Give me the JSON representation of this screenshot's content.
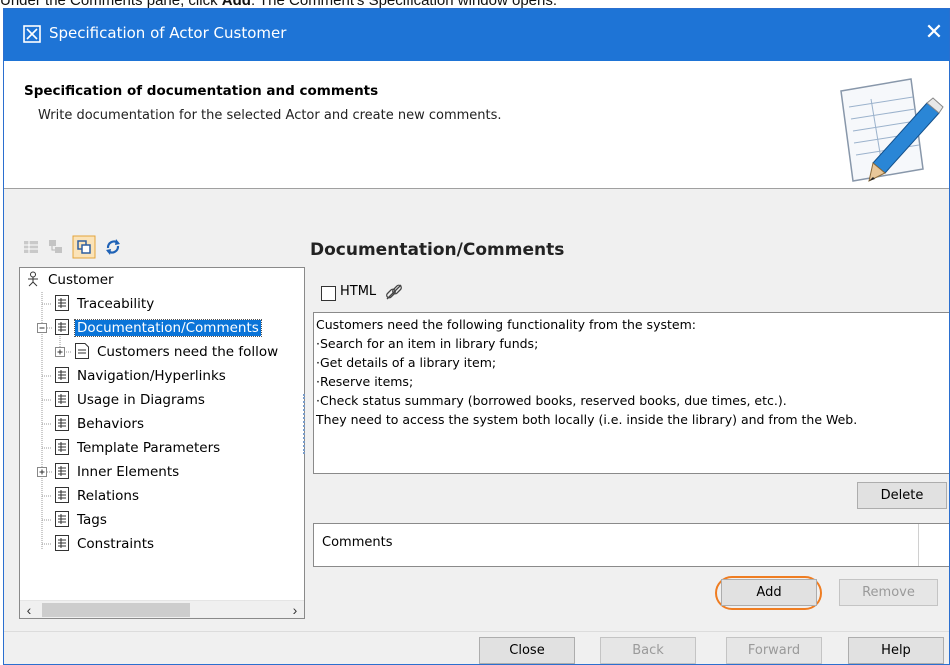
{
  "caption": {
    "prefix": "Under the Comments pane, click ",
    "bold": "Add",
    "suffix": ". The Comment's Specification window opens."
  },
  "window": {
    "title": "Specification of Actor Customer",
    "titlebar_color": "#1e74d6"
  },
  "header": {
    "title": "Specification of documentation and comments",
    "description": "Write documentation for the selected Actor and create new comments."
  },
  "toolbar": {
    "icons": [
      "list-view-icon",
      "tree-view-icon",
      "compact-view-icon",
      "refresh-icon"
    ]
  },
  "tree": {
    "root": "Customer",
    "items": [
      {
        "label": "Traceability"
      },
      {
        "label": "Documentation/Comments",
        "selected": true,
        "expanded": true
      },
      {
        "label": "Customers need the follow"
      },
      {
        "label": "Navigation/Hyperlinks"
      },
      {
        "label": "Usage in Diagrams"
      },
      {
        "label": "Behaviors"
      },
      {
        "label": "Template Parameters"
      },
      {
        "label": "Inner Elements"
      },
      {
        "label": "Relations"
      },
      {
        "label": "Tags"
      },
      {
        "label": "Constraints"
      }
    ]
  },
  "panel": {
    "title": "Documentation/Comments",
    "html_label": "HTML",
    "html_checked": false,
    "documentation": "Customers need the following functionality from the system:\n·Search for an item in library funds;\n·Get details of a library item;\n·Reserve items;\n·Check status summary (borrowed books, reserved books, due times, etc.).\nThey need to access the system both locally (i.e. inside the library) and from the Web.",
    "delete_label": "Delete",
    "comments_header": "Comments",
    "add_label": "Add",
    "remove_label": "Remove"
  },
  "footer": {
    "close_label": "Close",
    "back_label": "Back",
    "forward_label": "Forward",
    "help_label": "Help"
  },
  "colors": {
    "accent": "#0a74d8",
    "highlight": "#ef7d22"
  }
}
